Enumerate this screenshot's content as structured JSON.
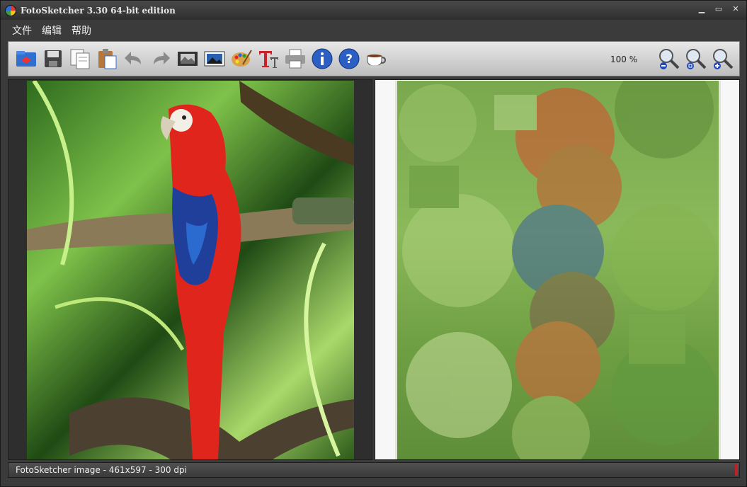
{
  "window": {
    "title": "FotoSketcher 3.30 64-bit edition"
  },
  "menu": {
    "items": [
      "文件",
      "编辑",
      "帮助"
    ]
  },
  "toolbar": {
    "zoom": "100 %",
    "buttons": [
      "open-icon",
      "save-icon",
      "copy-icon",
      "paste-icon",
      "undo-icon",
      "redo-icon",
      "filmstrip-icon",
      "picture-frame-icon",
      "palette-icon",
      "text-icon",
      "print-icon",
      "info-icon",
      "help-icon",
      "coffee-cup-icon"
    ],
    "zoom_buttons": [
      "zoom-out-icon",
      "zoom-fit-icon",
      "zoom-in-icon"
    ]
  },
  "status": {
    "text": "FotoSketcher image - 461x597 - 300 dpi"
  },
  "colors": {
    "accent": "#c0202a",
    "frame": "#3b3b3b"
  }
}
